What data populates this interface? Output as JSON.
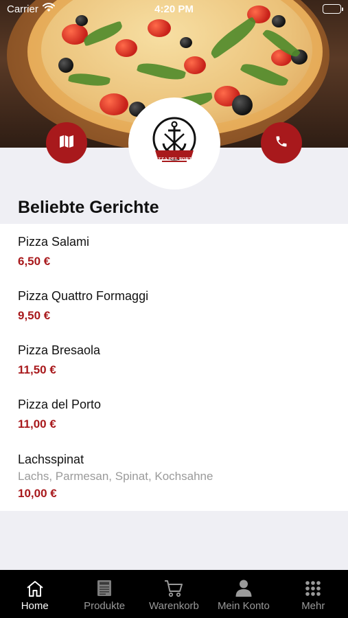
{
  "status_bar": {
    "carrier": "Carrier",
    "time": "4:20 PM"
  },
  "header": {
    "logo_text": "PIZZA DEL PORTO",
    "map_icon": "map-icon",
    "phone_icon": "phone-icon"
  },
  "section": {
    "title": "Beliebte Gerichte"
  },
  "dishes": [
    {
      "name": "Pizza Salami",
      "description": "",
      "price": "6,50 €"
    },
    {
      "name": "Pizza Quattro Formaggi",
      "description": "",
      "price": "9,50 €"
    },
    {
      "name": "Pizza Bresaola",
      "description": "",
      "price": "11,50 €"
    },
    {
      "name": "Pizza del Porto",
      "description": "",
      "price": "11,00 €"
    },
    {
      "name": "Lachsspinat",
      "description": "Lachs, Parmesan, Spinat, Kochsahne",
      "price": "10,00 €"
    }
  ],
  "tabbar": {
    "tabs": [
      {
        "label": "Home",
        "icon": "home-icon",
        "active": true
      },
      {
        "label": "Produkte",
        "icon": "menu-card-icon",
        "active": false
      },
      {
        "label": "Warenkorb",
        "icon": "cart-icon",
        "active": false
      },
      {
        "label": "Mein Konto",
        "icon": "user-icon",
        "active": false
      },
      {
        "label": "Mehr",
        "icon": "grid-icon",
        "active": false
      }
    ]
  },
  "colors": {
    "accent": "#a8191c",
    "tabbar_bg": "#000000",
    "page_bg": "#efeff4"
  }
}
